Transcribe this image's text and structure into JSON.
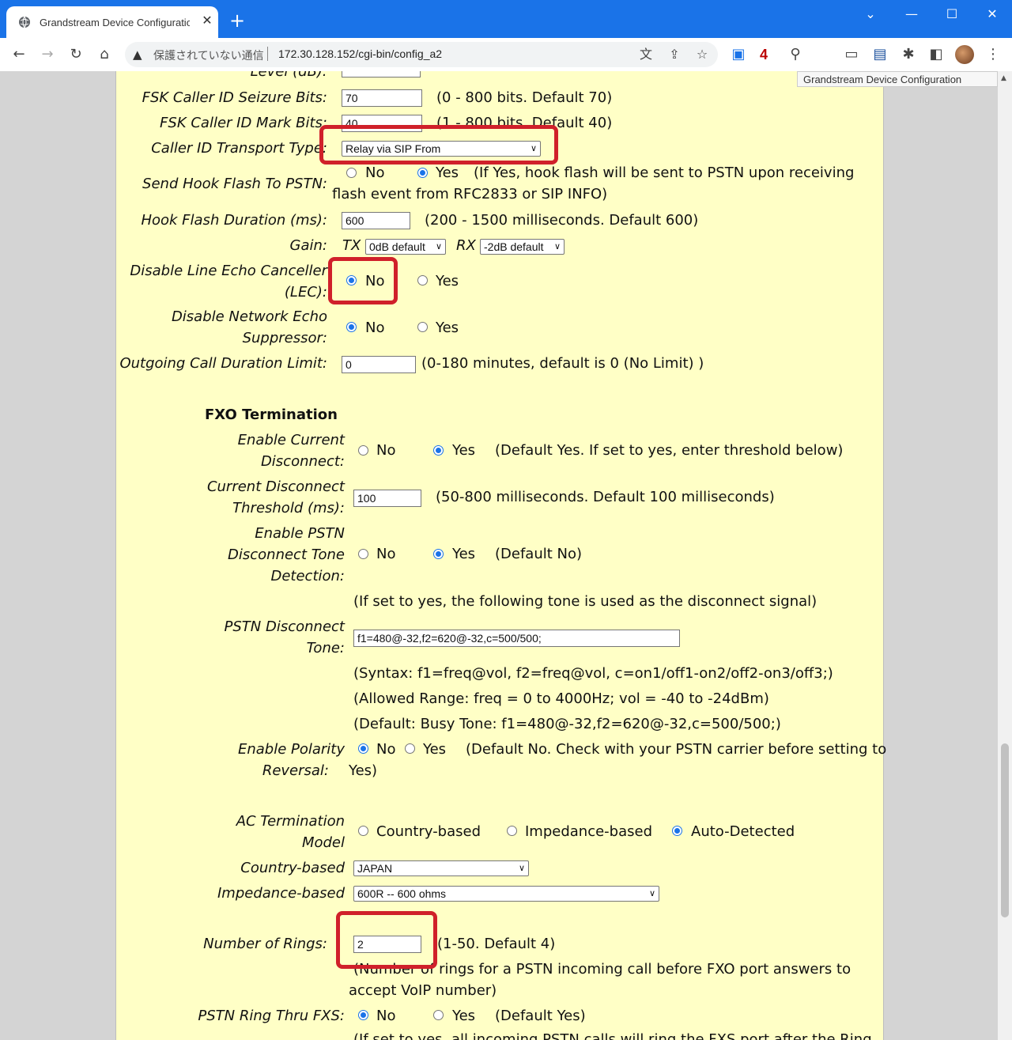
{
  "browser": {
    "tab_title": "Grandstream Device Configuratio",
    "security_label": "保護されていない通信",
    "url": "172.30.128.152/cgi-bin/config_a2",
    "ext_badge": "4",
    "tooltip": "Grandstream Device Configuration"
  },
  "form": {
    "level_label": "Level (dB):",
    "fsk_seizure": {
      "label": "FSK Caller ID Seizure Bits:",
      "value": "70",
      "hint": "(0 - 800 bits. Default 70)"
    },
    "fsk_mark": {
      "label": "FSK Caller ID Mark Bits:",
      "value": "40",
      "hint": "(1 - 800 bits. Default 40)"
    },
    "cid_transport": {
      "label": "Caller ID Transport Type:",
      "value": "Relay via SIP From"
    },
    "hook_flash_pstn": {
      "label": "Send Hook Flash To PSTN:",
      "no": "No",
      "yes": "Yes",
      "hint1": "(If Yes, hook flash will be sent to PSTN upon receiving",
      "hint2": "flash event from RFC2833 or SIP INFO)"
    },
    "hook_flash_dur": {
      "label": "Hook Flash Duration (ms):",
      "value": "600",
      "hint": "(200 - 1500 milliseconds. Default 600)"
    },
    "gain": {
      "label": "Gain:",
      "tx": "TX",
      "tx_value": "0dB default",
      "rx": "RX",
      "rx_value": "-2dB default"
    },
    "lec": {
      "label1": "Disable Line Echo Canceller",
      "label2": "(LEC):",
      "no": "No",
      "yes": "Yes"
    },
    "nes": {
      "label1": "Disable Network Echo",
      "label2": "Suppressor:",
      "no": "No",
      "yes": "Yes"
    },
    "call_limit": {
      "label": "Outgoing Call Duration Limit:",
      "value": "0",
      "hint": "(0-180 minutes, default is 0 (No Limit) )"
    },
    "fxo_title": "FXO Termination",
    "current_disc": {
      "label1": "Enable Current",
      "label2": "Disconnect:",
      "no": "No",
      "yes": "Yes",
      "hint": "(Default Yes.  If set to yes, enter threshold below)"
    },
    "current_thresh": {
      "label1": "Current Disconnect",
      "label2": "Threshold (ms):",
      "value": "100",
      "hint": "(50-800 milliseconds. Default 100 milliseconds)"
    },
    "pstn_tone_det": {
      "label1": "Enable PSTN",
      "label2": "Disconnect Tone",
      "label3": "Detection:",
      "no": "No",
      "yes": "Yes",
      "hint": "(Default No)"
    },
    "tone_note": "(If set to yes, the following tone is used as the disconnect signal)",
    "pstn_tone": {
      "label1": "PSTN Disconnect",
      "label2": "Tone:",
      "value": "f1=480@-32,f2=620@-32,c=500/500;",
      "syntax": "(Syntax: f1=freq@vol, f2=freq@vol, c=on1/off1-on2/off2-on3/off3;)",
      "range": "(Allowed Range: freq = 0 to 4000Hz; vol = -40 to -24dBm)",
      "default": "(Default: Busy Tone: f1=480@-32,f2=620@-32,c=500/500;)"
    },
    "polarity": {
      "label1": "Enable Polarity",
      "label2": "Reversal:",
      "no": "No",
      "yes": "Yes",
      "hint1": "(Default No. Check with your PSTN carrier before setting to",
      "hint2": "Yes)"
    },
    "ac_model": {
      "label1": "AC Termination",
      "label2": "Model",
      "opt1": "Country-based",
      "opt2": "Impedance-based",
      "opt3": "Auto-Detected"
    },
    "country": {
      "label": "Country-based",
      "value": "JAPAN"
    },
    "impedance": {
      "label": "Impedance-based",
      "value": "600R -- 600 ohms"
    },
    "rings": {
      "label": "Number of Rings:",
      "value": "2",
      "hint": "(1-50. Default 4)",
      "note1": "(Number of rings for a PSTN incoming call before FXO port answers to",
      "note2": "accept VoIP number)"
    },
    "ring_thru": {
      "label": "PSTN Ring Thru FXS:",
      "no": "No",
      "yes": "Yes",
      "hint": "(Default Yes)",
      "note": "(If set to yes, all incoming PSTN calls will ring the FXS port after the Ring"
    }
  }
}
